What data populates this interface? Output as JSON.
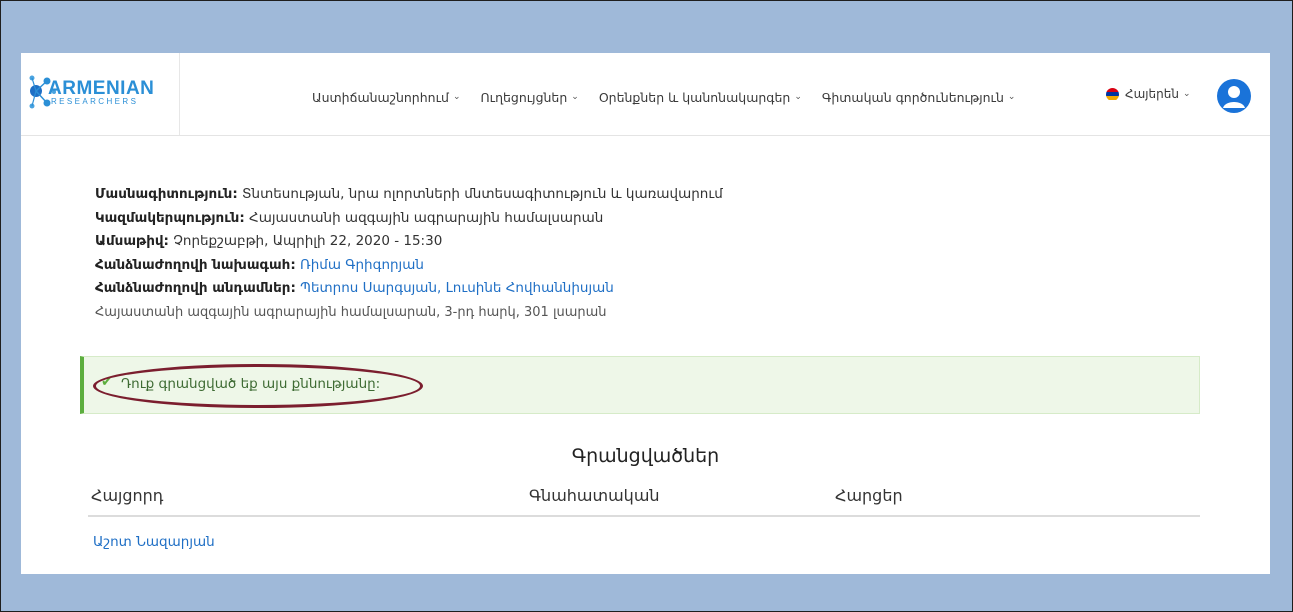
{
  "header": {
    "logo_text_top": "ARMENIAN",
    "logo_text_bottom": "RESEARCHERS",
    "nav": [
      {
        "label": "Աստիճանաշնորհում"
      },
      {
        "label": "Ուղեցույցներ"
      },
      {
        "label": "Օրենքներ և կանոնակարգեր"
      },
      {
        "label": "Գիտական գործունեություն"
      }
    ],
    "language": "Հայերեն",
    "flag_colors": [
      "#d90012",
      "#0033a0",
      "#f2a800"
    ]
  },
  "event": {
    "rows": [
      {
        "label": "Մասնագիտություն:",
        "value": "Տնտեսության, նրա ոլորտների մնտեսագիտություն և կառավարում"
      },
      {
        "label": "Կազմակերպություն:",
        "value": "Հայաստանի ազգային ագրարային համալսարան"
      },
      {
        "label": "Ամսաթիվ:",
        "value": "Չորեքշաբթի, Ապրիլի 22, 2020 - 15:30"
      },
      {
        "label": "Հանձնաժողովի նախագահ:",
        "value": "Ռիմա Գրիգորյան"
      },
      {
        "label": "Հանձնաժողովի անդամներ:",
        "value": "Պետրոս Սարգսյան, Լուսինե Հովհաննիսյան"
      }
    ],
    "address": "Հայաստանի ազգային ագրարային համալսարան, 3-րդ հարկ, 301 լսարան"
  },
  "alert": {
    "text": "Դուք գրանցված եք այս քննությանը:",
    "accent": "#5cae3e",
    "highlight_color": "#7b1e2e"
  },
  "registrations": {
    "title": "Գրանցվածներ",
    "columns": [
      "Հայցորդ",
      "Գնահատական",
      "Հարցեր"
    ],
    "rows": [
      {
        "applicant": "Աշոտ Նազարյան",
        "grade": "",
        "questions": ""
      }
    ]
  }
}
